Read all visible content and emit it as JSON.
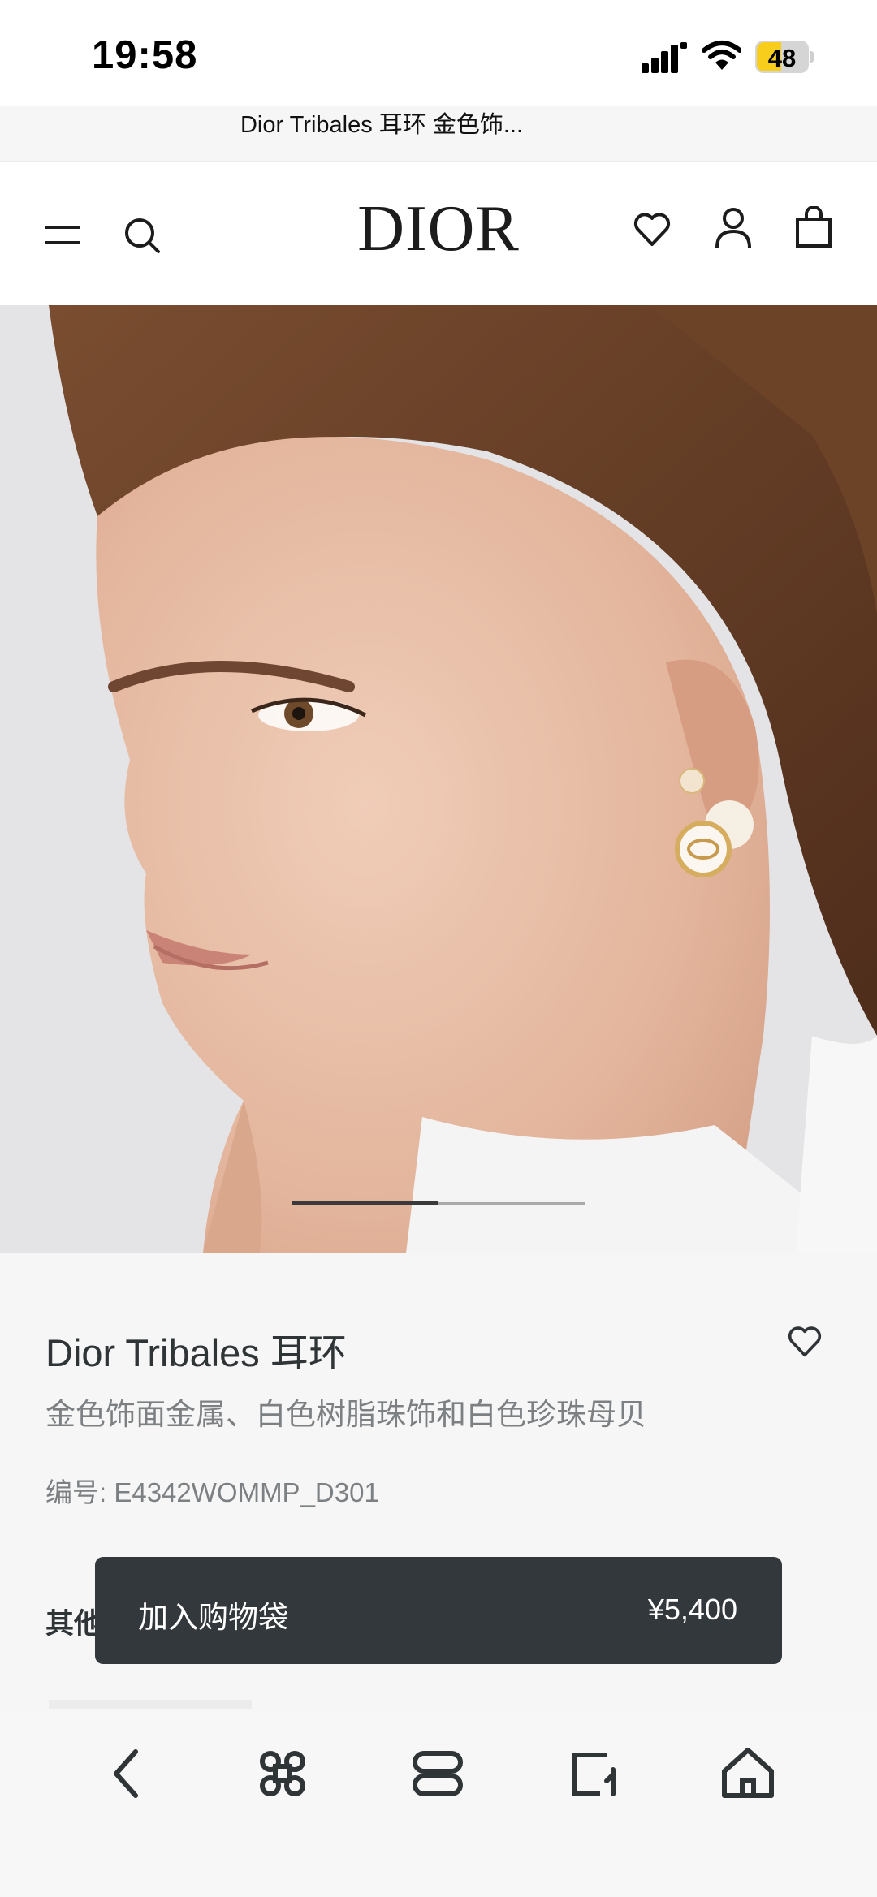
{
  "status_bar": {
    "time": "19:58",
    "battery_level": "48",
    "battery_color": "#f8cd1c"
  },
  "page": {
    "title": "Dior Tribales 耳环 金色饰..."
  },
  "header": {
    "brand": "DIOR",
    "icons": [
      "menu-icon",
      "search-icon",
      "heart-icon",
      "account-icon",
      "bag-icon"
    ]
  },
  "carousel": {
    "active_index": 1,
    "total": 2
  },
  "product": {
    "name": "Dior Tribales 耳环",
    "description": "金色饰面金属、白色树脂珠饰和白色珍珠母贝",
    "code": "编号: E4342WOMMP_D301",
    "other_label": "其他"
  },
  "cta": {
    "label": "加入购物袋",
    "price": "¥5,400",
    "color": "#33383c"
  },
  "browser_nav": [
    "back-icon",
    "command-icon",
    "tabs-icon",
    "share-icon",
    "home-icon"
  ]
}
